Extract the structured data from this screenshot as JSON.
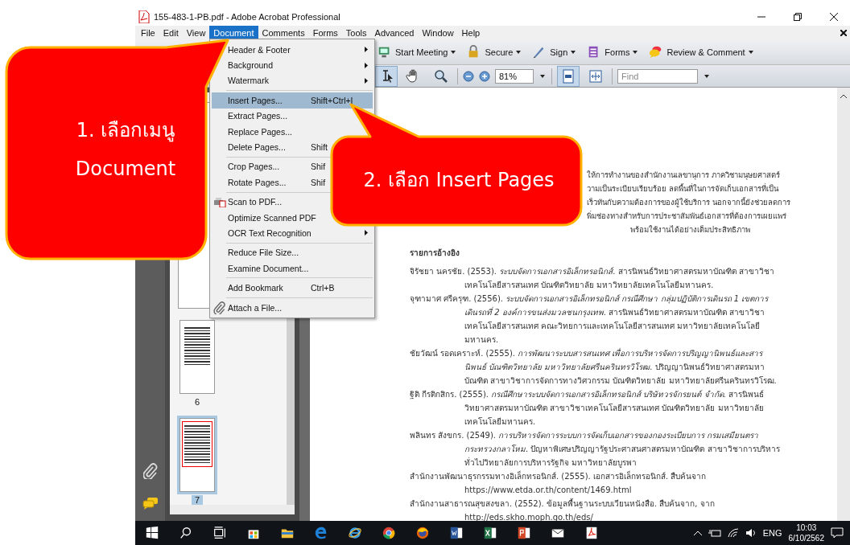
{
  "window": {
    "title": "155-483-1-PB.pdf - Adobe Acrobat Professional"
  },
  "menu_bar": [
    {
      "label": "File",
      "selected": false
    },
    {
      "label": "Edit",
      "selected": false
    },
    {
      "label": "View",
      "selected": false
    },
    {
      "label": "Document",
      "selected": true
    },
    {
      "label": "Comments",
      "selected": false
    },
    {
      "label": "Forms",
      "selected": false
    },
    {
      "label": "Tools",
      "selected": false
    },
    {
      "label": "Advanced",
      "selected": false
    },
    {
      "label": "Window",
      "selected": false
    },
    {
      "label": "Help",
      "selected": false
    }
  ],
  "document_menu": [
    {
      "kind": "item",
      "label": "Header & Footer",
      "submenu": true,
      "selected": false
    },
    {
      "kind": "item",
      "label": "Background",
      "submenu": true,
      "selected": false
    },
    {
      "kind": "item",
      "label": "Watermark",
      "submenu": true,
      "selected": false
    },
    {
      "kind": "separator"
    },
    {
      "kind": "item",
      "label": "Insert Pages...",
      "shortcut": "Shift+Ctrl+I",
      "submenu": false,
      "selected": true
    },
    {
      "kind": "item",
      "label": "Extract Pages...",
      "submenu": false,
      "selected": false
    },
    {
      "kind": "item",
      "label": "Replace Pages...",
      "submenu": false,
      "selected": false
    },
    {
      "kind": "item",
      "label": "Delete Pages...",
      "shortcut": "Shift",
      "submenu": false,
      "selected": false
    },
    {
      "kind": "separator"
    },
    {
      "kind": "item",
      "label": "Crop Pages...",
      "shortcut": "Shif",
      "submenu": false,
      "selected": false
    },
    {
      "kind": "item",
      "label": "Rotate Pages...",
      "shortcut": "Shif",
      "submenu": false,
      "selected": false
    },
    {
      "kind": "separator"
    },
    {
      "kind": "scan",
      "label": "Scan to PDF...",
      "submenu": false,
      "selected": false
    },
    {
      "kind": "item",
      "label": "Optimize Scanned PDF",
      "submenu": false,
      "selected": false
    },
    {
      "kind": "item",
      "label": "OCR Text Recognition",
      "submenu": true,
      "selected": false
    },
    {
      "kind": "separator"
    },
    {
      "kind": "item",
      "label": "Reduce File Size...",
      "submenu": false,
      "selected": false
    },
    {
      "kind": "item",
      "label": "Examine Document...",
      "submenu": false,
      "selected": false
    },
    {
      "kind": "separator"
    },
    {
      "kind": "item",
      "label": "Add Bookmark",
      "shortcut": "Ctrl+B",
      "submenu": false,
      "selected": false
    },
    {
      "kind": "separator"
    },
    {
      "kind": "attach",
      "label": "Attach a File...",
      "submenu": false,
      "selected": false
    }
  ],
  "toolbar": [
    {
      "label": "Start Meeting"
    },
    {
      "label": "Secure"
    },
    {
      "label": "Sign"
    },
    {
      "label": "Forms"
    },
    {
      "label": "Review & Comment"
    }
  ],
  "tools": [
    {
      "selected": true
    },
    {
      "selected": false
    },
    {
      "selected": false
    }
  ],
  "zoom": {
    "value": "81%"
  },
  "view_buttons": [
    {
      "selected": true
    },
    {
      "selected": false
    }
  ],
  "find": {
    "placeholder": "Find"
  },
  "thumbnails": [
    {
      "label": "6",
      "selected": false
    },
    {
      "label": "7",
      "selected": true
    }
  ],
  "document": {
    "paragraph_fragments": [
      "ให้การทำงานของสำนักงานเลขานุการ ภาควิชามนุษยศาสตร์",
      "วามเป็นระเบียบเรียบร้อย ลดพื้นที่ในการจัดเก็บเอกสารที่เป็น",
      "เร็วทันกับความต้องการของผู้ใช้บริการ นอกจากนี้ยังช่วยลดการ",
      "พิ่มช่องทางสำหรับการประชาสัมพันธ์เอกสารที่ต้องการเผยแพร่",
      "พร้อมใช้งานได้อย่างเต็มประสิทธิภาพ"
    ],
    "heading": "รายการอ้างอิง",
    "references": [
      {
        "text": "จิรัชยา นครชัย. (2553). *ระบบจัดการเอกสารอิเล็กทรอนิกส์*. สารนิพนธ์วิทยาศาสตรมหาบัณฑิต สาขาวิชาเทคโนโลยีสารสนเทศ บัณฑิตวิทยาลัย มหาวิทยาลัยเทคโนโลยีมหานคร."
      },
      {
        "text": "จุฑามาศ ศรีครุฑ. (2556). *ระบบจัดการเอกสารอิเล็กทรอนิกส์ กรณีศึกษา กลุ่มปฏิบัติการเดินรถ 1 เขตการเดินรถที่ 2 องค์การขนส่งมวลชนกรุงเทพ*. สารนิพนธ์วิทยาศาสตรมหาบัณฑิต สาขาวิชาเทคโนโลยีสารสนเทศ คณะวิทยการและเทคโนโลยีสารสนเทศ มหาวิทยาลัยเทคโนโลยีมหานคร."
      },
      {
        "text": "ชัยวัฒน์ รอดเคราะห์. (2555). *การพัฒนาระบบสารสนเทศ เพื่อการบริหารจัดการปริญญานิพนธ์และสารนิพนธ์ บัณฑิตวิทยาลัย มหาวิทยาลัยศรีนครินทรวิโรฒ*. ปริญญานิพนธ์วิทยาศาสตรมหาบัณฑิต สาขาวิชาการจัดการทางวิศวกรรม บัณฑิตวิทยาลัย มหาวิทยาลัยศรีนครินทรวิโรฒ."
      },
      {
        "text": "ฐิติ กีรติกสิกร. (2555). *กรณีศึกษาระบบจัดการเอกสารอิเล็กทรอนิกส์ บริษัทวรจักรยนต์ จำกัด*. สารนิพนธ์วิทยาศาสตรมหาบัณฑิต สาขาวิชาเทคโนโลยีสารสนเทศ บัณฑิตวิทยาลัย มหาวิทยาลัยเทคโนโลยีมหานคร."
      },
      {
        "text": "พลินทร สังขกร. (2549). *การบริหารจัดการระบบการจัดเก็บเอกสารของกองระเบียบการ กรมเสมียนตรา กระทรวงกลาโหม*. ปัญหาพิเศษปริญญารัฐประศาสนศาสตรมหาบัณฑิต สาขาวิชาการบริหารทั่วไปวิทยาลัยการบริหารรัฐกิจ มหาวิทยาลัยบูรพา"
      },
      {
        "text": "สำนักงานพัฒนาธุรกรรมทางอิเล็กทรอนิกส์. (2555). เอกสารอิเล็กทรอนิกส์. สืบค้นจาก",
        "url": "https://www.etda.or.th/content/1469.html"
      },
      {
        "text": "สำนักงานสาธารณสุขสงขลา. (2552). ข้อมูลพื้นฐานระบบเวียนหนังสือ. สืบค้นจาก, จาก",
        "url": "http://eds.skho.moph.go.th/eds/"
      }
    ]
  },
  "callouts": [
    {
      "text": "1. เลือกเมนู\nDocument"
    },
    {
      "text": "2. เลือก Insert Pages"
    }
  ],
  "taskbar": {
    "language": "ENG",
    "time": "10:03",
    "date": "6/10/2562"
  }
}
